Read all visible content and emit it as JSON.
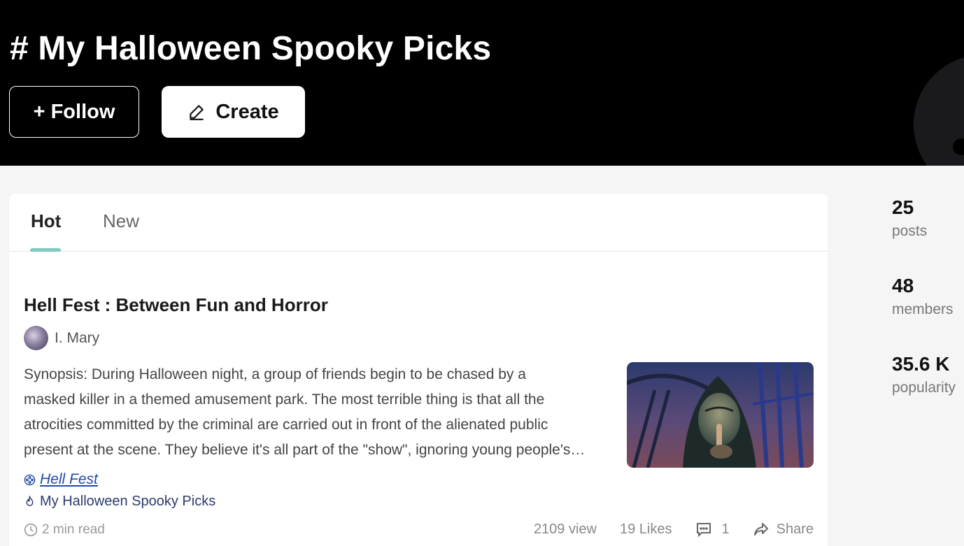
{
  "hero": {
    "title": "# My Halloween Spooky Picks",
    "follow_label": "+ Follow",
    "create_label": "Create"
  },
  "tabs": [
    {
      "label": "Hot",
      "active": true
    },
    {
      "label": "New",
      "active": false
    }
  ],
  "post": {
    "title": "Hell Fest : Between Fun and Horror",
    "author": "I. Mary",
    "synopsis": "Synopsis: During Halloween night, a group of friends begin to be chased by a\nmasked killer in a themed amusement park. The most terrible thing is that all the\natrocities committed by the criminal are carried out in front of the alienated public\npresent at the scene. They believe it's all part of the \"show\", ignoring young people's…",
    "movie_tag": "Hell Fest",
    "topic_tag": "My Halloween Spooky Picks",
    "read_time": "2 min read",
    "views": "2109 view",
    "likes": "19 Likes",
    "comments": "1",
    "share_label": "Share"
  },
  "stats": [
    {
      "value": "25",
      "label": "posts"
    },
    {
      "value": "48",
      "label": "members"
    },
    {
      "value": "35.6 K",
      "label": "popularity"
    }
  ],
  "colors": {
    "hero_bg": "#000000",
    "tab_accent": "#7ecbc4",
    "link": "#1f4aa3"
  }
}
